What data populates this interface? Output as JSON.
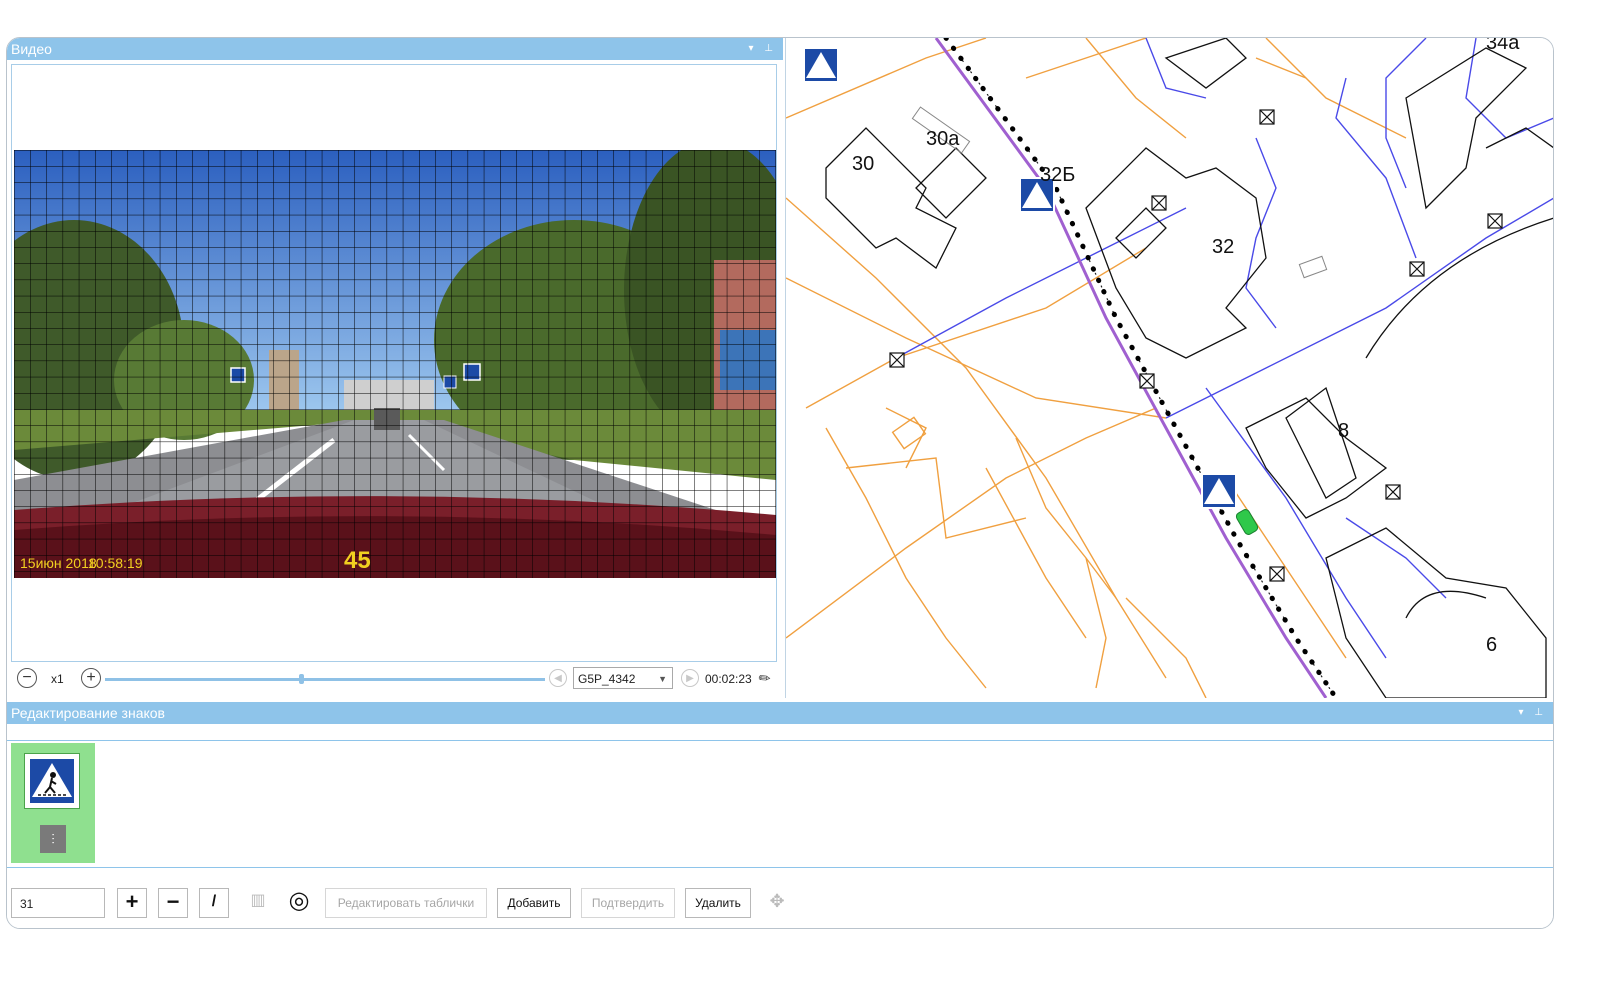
{
  "video_panel": {
    "title": "Видео",
    "overlay": {
      "date": "15июн 2018",
      "time": "10:58:19",
      "speed": "45"
    },
    "controls": {
      "zoom_level": "x1",
      "progress_fraction": 0.44,
      "file_selected": "G5P_4342",
      "elapsed_time": "00:02:23"
    }
  },
  "map": {
    "building_labels": [
      "30",
      "30a",
      "32Б",
      "32",
      "34a",
      "8",
      "6"
    ]
  },
  "signs_panel": {
    "title": "Редактирование знаков",
    "toolbar": {
      "number_value": "31",
      "edit_plates_label": "Редактировать таблички",
      "add_label": "Добавить",
      "confirm_label": "Подтвердить",
      "delete_label": "Удалить"
    }
  },
  "colors": {
    "header_bg": "#8ec4ea",
    "accent_blue": "#4a4ae8",
    "accent_orange": "#f0a040",
    "accent_purple": "#a060d0",
    "sign_selected_bg": "#8fe08f"
  },
  "icons": [
    "zoom-out-icon",
    "zoom-in-icon",
    "prev-icon",
    "next-icon",
    "ruler-icon",
    "pin-icon",
    "plus-icon",
    "minus-icon",
    "pencil-icon",
    "plate-icon",
    "target-icon",
    "move-icon",
    "pedestrian-crossing-sign-icon",
    "car-marker-icon"
  ]
}
